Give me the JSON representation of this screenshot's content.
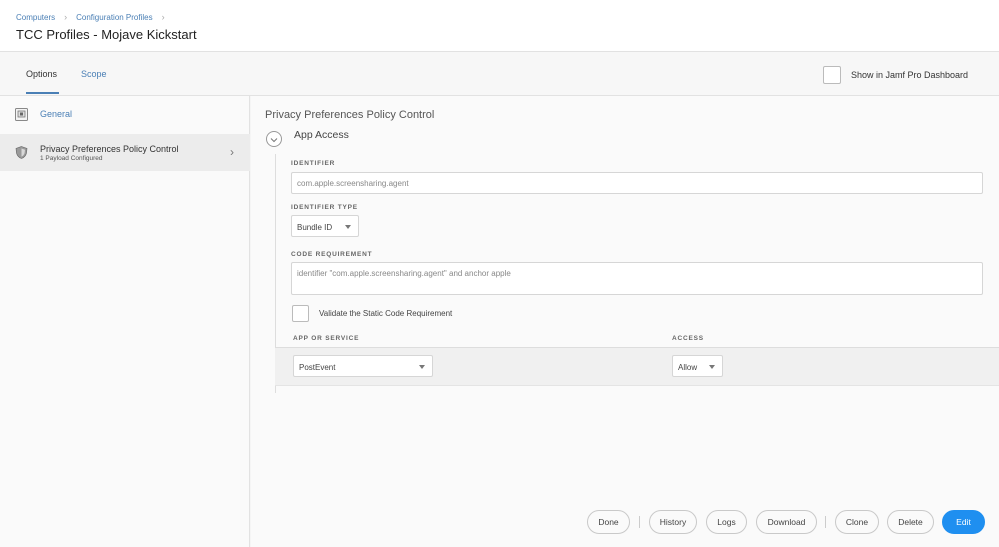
{
  "header": {
    "breadcrumb": [
      "Computers",
      "Configuration Profiles"
    ],
    "title": "TCC Profiles - Mojave Kickstart"
  },
  "tabs": [
    {
      "label": "Options",
      "active": true
    },
    {
      "label": "Scope",
      "active": false
    }
  ],
  "dashboard_option": {
    "label": "Show in Jamf Pro Dashboard",
    "checked": false
  },
  "sidebar": {
    "items": [
      {
        "label": "General",
        "icon": "general-settings-icon"
      },
      {
        "label": "Privacy Preferences Policy Control",
        "sublabel": "1 Payload Configured",
        "icon": "shield-icon",
        "selected": true
      }
    ]
  },
  "main": {
    "section_title": "Privacy Preferences Policy Control",
    "subsection_title": "App Access",
    "identifier": {
      "label": "IDENTIFIER",
      "value": "com.apple.screensharing.agent"
    },
    "identifier_type": {
      "label": "IDENTIFIER TYPE",
      "value": "Bundle ID"
    },
    "code_requirement": {
      "label": "CODE REQUIREMENT",
      "value": "identifier \"com.apple.screensharing.agent\" and anchor apple"
    },
    "validate": {
      "label": "Validate the Static Code Requirement",
      "checked": false
    },
    "table": {
      "columns": [
        "APP OR SERVICE",
        "ACCESS"
      ],
      "rows": [
        {
          "service": "PostEvent",
          "access": "Allow"
        }
      ]
    }
  },
  "footer": {
    "buttons": [
      "Done",
      "History",
      "Logs",
      "Download",
      "Clone",
      "Delete",
      "Edit"
    ]
  },
  "colors": {
    "accent": "#1f8ff0",
    "link": "#4a7fb5"
  }
}
